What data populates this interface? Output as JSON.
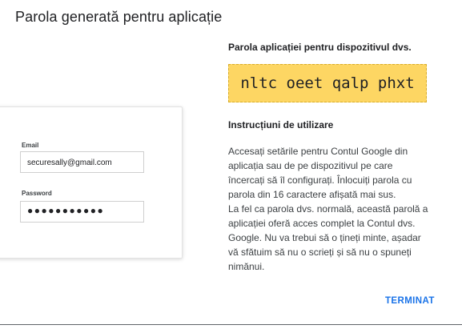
{
  "dialog": {
    "title": "Parola generată pentru aplicație"
  },
  "login_card": {
    "email_label": "Email",
    "email_value": "securesally@gmail.com",
    "password_label": "Password",
    "password_value": "●●●●●●●●●●●"
  },
  "app_password": {
    "heading": "Parola aplicației pentru dispozitivul dvs.",
    "value": "nltc oeet qalp phxt",
    "chip_color": "#fdd663"
  },
  "instructions": {
    "heading": "Instrucțiuni de utilizare",
    "lines": [
      "Accesați setările pentru Contul Google din",
      "aplicația sau de pe dispozitivul pe care",
      "încercați să îl configurați. Înlocuiți parola cu",
      "parola din 16 caractere afișată mai sus.",
      "La fel ca parola dvs. normală, această parolă a",
      "aplicației oferă acces complet la Contul dvs.",
      "Google. Nu va trebui să o țineți minte, așadar",
      "vă sfătuim să nu o scrieți și să nu o spuneți",
      "nimănui."
    ]
  },
  "actions": {
    "done_label": "TERMINAT",
    "accent_color": "#1a73e8"
  }
}
